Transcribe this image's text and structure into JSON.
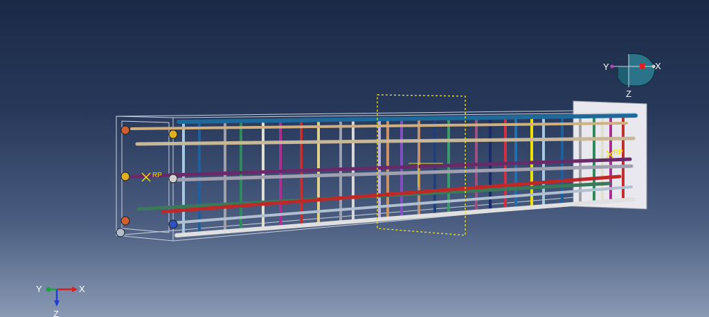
{
  "viewport": {
    "background_top": "#1b2a46",
    "background_bottom": "#8a9ab4"
  },
  "triad": {
    "x_label": "X",
    "y_label": "Y",
    "z_label": "Z",
    "x_color": "#d62020",
    "y_color": "#1fa040",
    "z_color": "#2040d0"
  },
  "view_cube": {
    "x_label": "X",
    "y_label": "Y",
    "z_label": "Z"
  },
  "model": {
    "reference_point_label": "RP",
    "partition_color": "#f0e000",
    "stirrup_colors": [
      "#a8c8e0",
      "#1e5fa0",
      "#a0a0a8",
      "#2e8a5a",
      "#e0e0d0",
      "#a83090",
      "#c03030",
      "#e0d090",
      "#9aa0b0",
      "#d8d8d8",
      "#c0b0e0",
      "#d09060",
      "#8050c0",
      "#c09070",
      "#20407a",
      "#3a9a6a",
      "#a05080",
      "#1a2a6a",
      "#d03040",
      "#2070b0",
      "#f0e000"
    ],
    "bar_colors": [
      "#1e6a9a",
      "#d0b080",
      "#c8b898",
      "#6a2a6a",
      "#a0a0b0",
      "#3a7a5a",
      "#c02828",
      "#b0c0d0",
      "#e0e0e0"
    ]
  }
}
